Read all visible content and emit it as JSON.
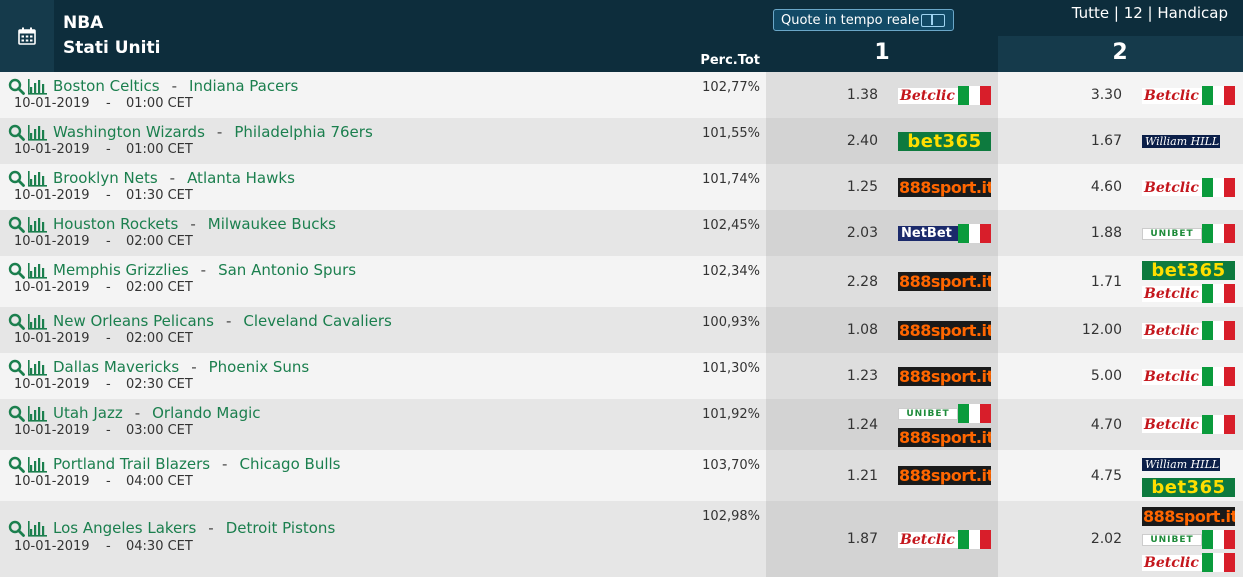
{
  "header": {
    "league": "NBA",
    "country": "Stati Uniti",
    "perc_label": "Perc.Tot",
    "col1_label": "1",
    "col2_label": "2",
    "realtime_label": "Quote in tempo reale",
    "filters": "Tutte | 12 | Handicap"
  },
  "colors": {
    "header_bg": "#0d2d3c",
    "team_link": "#1b7f4e"
  },
  "matches": [
    {
      "home": "Boston Celtics",
      "away": "Indiana Pacers",
      "date": "10-01-2019",
      "time": "01:00 CET",
      "perc": "102,77%",
      "odd1": "1.38",
      "book1": [
        "betclic"
      ],
      "odd2": "3.30",
      "book2": [
        "betclic"
      ]
    },
    {
      "home": "Washington Wizards",
      "away": "Philadelphia 76ers",
      "date": "10-01-2019",
      "time": "01:00 CET",
      "perc": "101,55%",
      "odd1": "2.40",
      "book1": [
        "bet365"
      ],
      "odd2": "1.67",
      "book2": [
        "williamhill"
      ]
    },
    {
      "home": "Brooklyn Nets",
      "away": "Atlanta Hawks",
      "date": "10-01-2019",
      "time": "01:30 CET",
      "perc": "101,74%",
      "odd1": "1.25",
      "book1": [
        "888sport"
      ],
      "odd2": "4.60",
      "book2": [
        "betclic"
      ]
    },
    {
      "home": "Houston Rockets",
      "away": "Milwaukee Bucks",
      "date": "10-01-2019",
      "time": "02:00 CET",
      "perc": "102,45%",
      "odd1": "2.03",
      "book1": [
        "netbet"
      ],
      "odd2": "1.88",
      "book2": [
        "unibet"
      ]
    },
    {
      "home": "Memphis Grizzlies",
      "away": "San Antonio Spurs",
      "date": "10-01-2019",
      "time": "02:00 CET",
      "perc": "102,34%",
      "odd1": "2.28",
      "book1": [
        "888sport"
      ],
      "odd2": "1.71",
      "book2": [
        "bet365",
        "betclic"
      ]
    },
    {
      "home": "New Orleans Pelicans",
      "away": "Cleveland Cavaliers",
      "date": "10-01-2019",
      "time": "02:00 CET",
      "perc": "100,93%",
      "odd1": "1.08",
      "book1": [
        "888sport"
      ],
      "odd2": "12.00",
      "book2": [
        "betclic"
      ]
    },
    {
      "home": "Dallas Mavericks",
      "away": "Phoenix Suns",
      "date": "10-01-2019",
      "time": "02:30 CET",
      "perc": "101,30%",
      "odd1": "1.23",
      "book1": [
        "888sport"
      ],
      "odd2": "5.00",
      "book2": [
        "betclic"
      ]
    },
    {
      "home": "Utah Jazz",
      "away": "Orlando Magic",
      "date": "10-01-2019",
      "time": "03:00 CET",
      "perc": "101,92%",
      "odd1": "1.24",
      "book1": [
        "unibet",
        "888sport"
      ],
      "odd2": "4.70",
      "book2": [
        "betclic"
      ]
    },
    {
      "home": "Portland Trail Blazers",
      "away": "Chicago Bulls",
      "date": "10-01-2019",
      "time": "04:00 CET",
      "perc": "103,70%",
      "odd1": "1.21",
      "book1": [
        "888sport"
      ],
      "odd2": "4.75",
      "book2": [
        "williamhill",
        "bet365"
      ]
    },
    {
      "home": "Los Angeles Lakers",
      "away": "Detroit Pistons",
      "date": "10-01-2019",
      "time": "04:30 CET",
      "perc": "102,98%",
      "odd1": "1.87",
      "book1": [
        "betclic"
      ],
      "odd2": "2.02",
      "book2": [
        "888sport",
        "unibet",
        "betclic"
      ]
    }
  ],
  "bookmakers": {
    "betclic": "Betclic",
    "bet365": "bet365",
    "888sport": "888sport.it",
    "netbet": "NetBet",
    "unibet": "UNIBET",
    "williamhill": "William HILL"
  }
}
